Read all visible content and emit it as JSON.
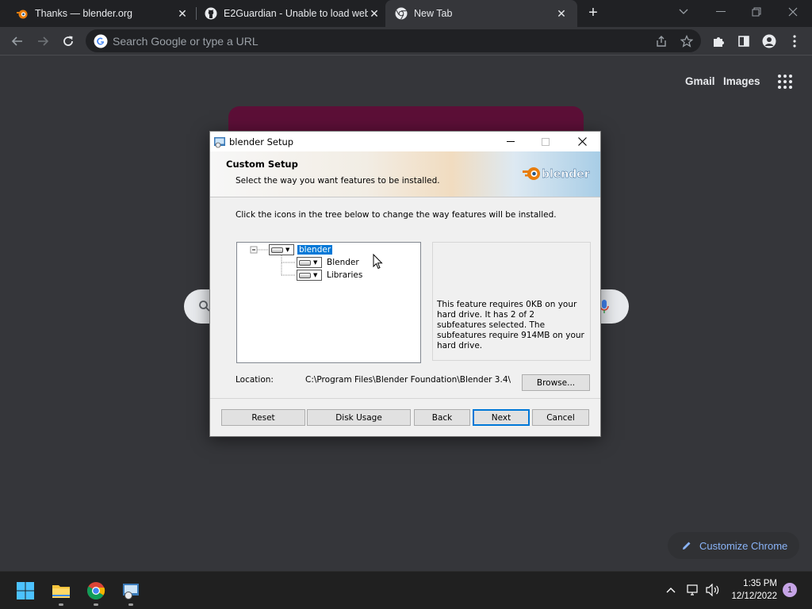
{
  "browser": {
    "tabs": [
      {
        "title": "Thanks — blender.org",
        "favicon": "blender-icon"
      },
      {
        "title": "E2Guardian - Unable to load web",
        "favicon": "github-icon"
      },
      {
        "title": "New Tab",
        "favicon": "chrome-icon",
        "active": true
      }
    ],
    "omnibox_placeholder": "Search Google or type a URL"
  },
  "ntp": {
    "gmail": "Gmail",
    "images": "Images",
    "customize": "Customize Chrome"
  },
  "dialog": {
    "title": "blender Setup",
    "heading": "Custom Setup",
    "subheading": "Select the way you want features to be installed.",
    "logo_text": "blender",
    "instruction": "Click the icons in the tree below to change the way features will be installed.",
    "tree": {
      "root": "blender",
      "children": [
        "Blender",
        "Libraries"
      ]
    },
    "description": "This feature requires 0KB on your hard drive. It has 2 of 2 subfeatures selected. The subfeatures require 914MB on your hard drive.",
    "location_label": "Location:",
    "location_path": "C:\\Program Files\\Blender Foundation\\Blender 3.4\\",
    "buttons": {
      "browse": "Browse...",
      "reset": "Reset",
      "disk_usage": "Disk Usage",
      "back": "Back",
      "next": "Next",
      "cancel": "Cancel"
    }
  },
  "taskbar": {
    "time": "1:35 PM",
    "date": "12/12/2022",
    "notifications": "1"
  },
  "colors": {
    "accent": "#0078d7",
    "chrome_dark": "#202124",
    "ntp_bg": "#35363a",
    "doodle": "#5c0f37",
    "blender_orange": "#e87d0d"
  }
}
